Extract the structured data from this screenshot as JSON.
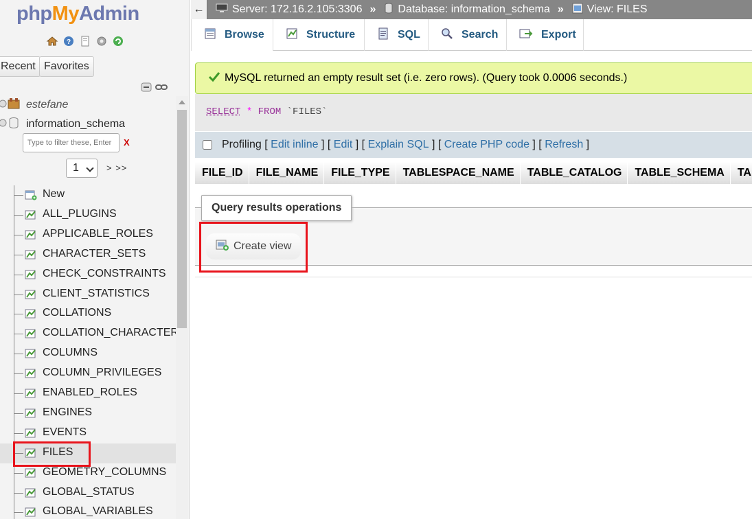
{
  "sidebar": {
    "logo": {
      "php": "php",
      "my": "My",
      "admin": "Admin"
    },
    "nav_icons": [
      "home-icon",
      "help-icon",
      "docs-icon",
      "settings-icon",
      "reload-icon"
    ],
    "tabs": {
      "recent": "Recent",
      "favorites": "Favorites"
    },
    "databases": [
      {
        "name": "estefane"
      },
      {
        "name": "information_schema"
      }
    ],
    "filter_placeholder": "Type to filter these, Enter",
    "filter_clear": "X",
    "pager": {
      "value": "1",
      "next": "> >>"
    },
    "tables": [
      "New",
      "ALL_PLUGINS",
      "APPLICABLE_ROLES",
      "CHARACTER_SETS",
      "CHECK_CONSTRAINTS",
      "CLIENT_STATISTICS",
      "COLLATIONS",
      "COLLATION_CHARACTER_SET_APPLICABILITY",
      "COLUMNS",
      "COLUMN_PRIVILEGES",
      "ENABLED_ROLES",
      "ENGINES",
      "EVENTS",
      "FILES",
      "GEOMETRY_COLUMNS",
      "GLOBAL_STATUS",
      "GLOBAL_VARIABLES"
    ],
    "selected_table": "FILES"
  },
  "breadcrumb": {
    "back": "←",
    "server": "Server: 172.16.2.105:3306",
    "database": "Database: information_schema",
    "view": "View: FILES",
    "sep": "»"
  },
  "tabs": {
    "browse": "Browse",
    "structure": "Structure",
    "sql": "SQL",
    "search": "Search",
    "export": "Export"
  },
  "message": "MySQL returned an empty result set (i.e. zero rows). (Query took 0.0006 seconds.)",
  "sql": {
    "select": "SELECT",
    "star": "*",
    "from": "FROM",
    "table": "`FILES`"
  },
  "profiling": {
    "label": "Profiling",
    "links": [
      "Edit inline",
      "Edit",
      "Explain SQL",
      "Create PHP code",
      "Refresh"
    ]
  },
  "columns": [
    "FILE_ID",
    "FILE_NAME",
    "FILE_TYPE",
    "TABLESPACE_NAME",
    "TABLE_CATALOG",
    "TABLE_SCHEMA",
    "TABLE_NAME"
  ],
  "query_ops": {
    "title": "Query results operations",
    "create_view": "Create view"
  },
  "colors": {
    "accent": "#235a81",
    "highlight": "#e8131b",
    "success_bg": "#ebf8a4"
  }
}
